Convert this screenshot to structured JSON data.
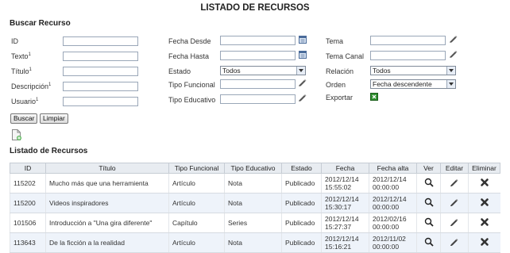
{
  "page": {
    "title": "LISTADO DE RECURSOS"
  },
  "search": {
    "heading": "Buscar Recurso",
    "fields": {
      "id": "ID",
      "texto": "Texto",
      "titulo": "Título",
      "descripcion": "Descripción",
      "usuario": "Usuario",
      "fecha_desde": "Fecha Desde",
      "fecha_hasta": "Fecha Hasta",
      "estado": "Estado",
      "tipo_funcional": "Tipo Funcional",
      "tipo_educativo": "Tipo Educativo",
      "tema": "Tema",
      "tema_canal": "Tema Canal",
      "relacion": "Relación",
      "orden": "Orden",
      "exportar": "Exportar"
    },
    "footnote_mark": "1",
    "estado_value": "Todos",
    "relacion_value": "Todos",
    "orden_value": "Fecha descendente",
    "buttons": {
      "buscar": "Buscar",
      "limpiar": "Limpiar"
    }
  },
  "icons": {
    "calendar": "calendar-icon",
    "pencil": "pencil-icon",
    "excel": "excel-export-icon",
    "new_doc": "new-document-icon",
    "view": "magnifier-icon",
    "edit": "pencil-icon",
    "delete": "delete-x-icon"
  },
  "list": {
    "heading": "Listado de Recursos",
    "columns": [
      "ID",
      "Título",
      "Tipo Funcional",
      "Tipo Educativo",
      "Estado",
      "Fecha",
      "Fecha alta",
      "Ver",
      "Editar",
      "Eliminar"
    ],
    "rows": [
      {
        "id": "115202",
        "titulo": "Mucho más que una herramienta",
        "tipo_funcional": "Artículo",
        "tipo_educativo": "Nota",
        "estado": "Publicado",
        "fecha": [
          "2012/12/14",
          "15:55:02"
        ],
        "fecha_alta": [
          "2012/12/14",
          "00:00:00"
        ]
      },
      {
        "id": "115200",
        "titulo": "Videos inspiradores",
        "tipo_funcional": "Artículo",
        "tipo_educativo": "Nota",
        "estado": "Publicado",
        "fecha": [
          "2012/12/14",
          "15:30:17"
        ],
        "fecha_alta": [
          "2012/12/14",
          "00:00:00"
        ]
      },
      {
        "id": "101506",
        "titulo": "Introducción a \"Una gira diferente\"",
        "tipo_funcional": "Capítulo",
        "tipo_educativo": "Series",
        "estado": "Publicado",
        "fecha": [
          "2012/12/14",
          "15:27:37"
        ],
        "fecha_alta": [
          "2012/02/16",
          "00:00:00"
        ]
      },
      {
        "id": "113643",
        "titulo": "De la ficción a la realidad",
        "tipo_funcional": "Artículo",
        "tipo_educativo": "Nota",
        "estado": "Publicado",
        "fecha": [
          "2012/12/14",
          "15:16:21"
        ],
        "fecha_alta": [
          "2012/11/02",
          "00:00:00"
        ]
      }
    ]
  }
}
